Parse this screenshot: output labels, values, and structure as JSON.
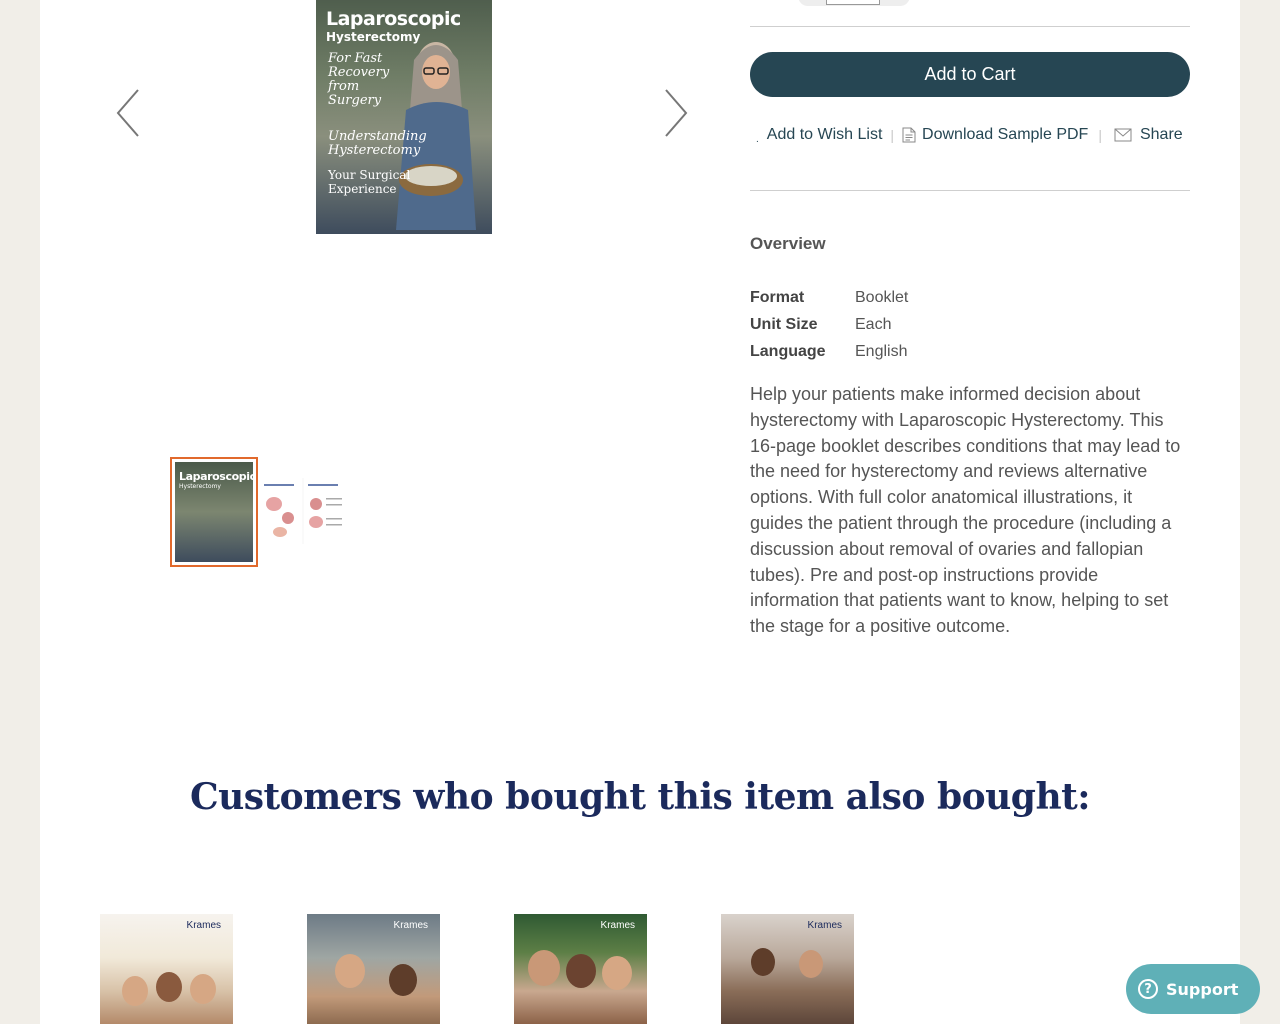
{
  "product": {
    "cover": {
      "title": "Laparoscopic",
      "subtitle": "Hysterectomy",
      "tagline": "For Fast Recovery from Surgery",
      "line2": "Understanding Hysterectomy",
      "line3": "Your Surgical Experience"
    },
    "add_to_cart_label": "Add to Cart",
    "actions": {
      "wishlist": "Add to Wish List",
      "sample_pdf": "Download Sample PDF",
      "share": "Share"
    },
    "overview": {
      "title": "Overview",
      "specs": [
        {
          "key": "Format",
          "value": "Booklet"
        },
        {
          "key": "Unit Size",
          "value": "Each"
        },
        {
          "key": "Language",
          "value": "English"
        }
      ],
      "description": "Help your patients make informed decision about hysterectomy with Laparoscopic Hysterectomy. This 16-page booklet describes conditions that may lead to the need for hysterectomy and reviews alternative options. With full color anatomical illustrations, it guides the patient through the procedure (including a discussion about removal of ovaries and fallopian tubes). Pre and post-op instructions provide information that patients want to know, helping to set the stage for a positive outcome."
    }
  },
  "also_bought": {
    "title": "Customers who bought this item also bought:",
    "items": [
      {
        "brand": "Krames"
      },
      {
        "brand": "Krames"
      },
      {
        "brand": "Krames"
      },
      {
        "brand": "Krames"
      }
    ]
  },
  "support": {
    "label": "Support"
  },
  "colors": {
    "primary": "#264653",
    "accent_thumb_border": "#e1692c",
    "heading_navy": "#1b2a5c",
    "support_teal": "#5fb0b7"
  }
}
